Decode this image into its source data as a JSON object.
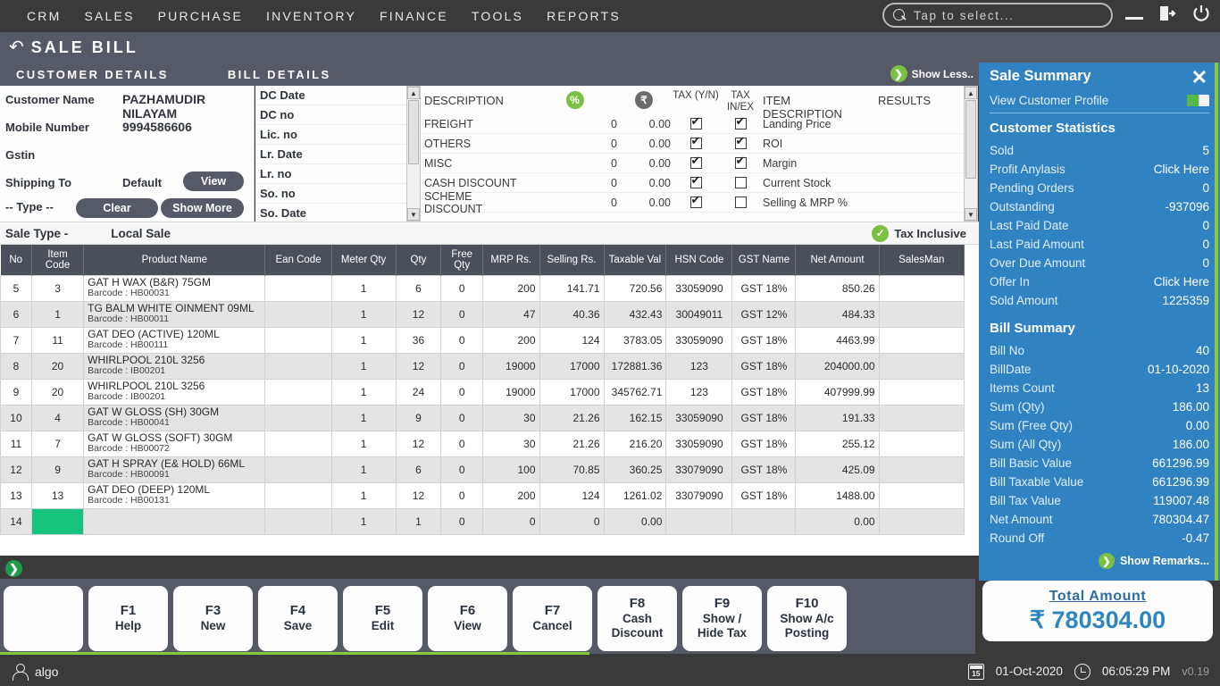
{
  "topnav": {
    "menus": [
      "CRM",
      "SALES",
      "PURCHASE",
      "INVENTORY",
      "FINANCE",
      "TOOLS",
      "REPORTS"
    ],
    "search_placeholder": "Tap to select...",
    "search_icon": "search-icon",
    "minimize_label": "—",
    "logout_icon": "logout-icon",
    "power_icon": "power-icon",
    "bg": "#3a3a3a"
  },
  "titlebar": {
    "back_icon": "↰",
    "title": "SALE BILL",
    "bg": "#555a66"
  },
  "sections": {
    "customer_details": "CUSTOMER DETAILS",
    "bill_details": "BILL DETAILS",
    "show_less": "Show Less..",
    "show_less_icon": "chevron-right-icon"
  },
  "customer": {
    "fields": [
      {
        "label": "Customer Name",
        "value": "PAZHAMUDIR NILAYAM"
      },
      {
        "label": "Mobile Number",
        "value": "9994586606"
      },
      {
        "label": "Gstin",
        "value": ""
      },
      {
        "label": "Shipping To",
        "value": ""
      },
      {
        "label": "-- Type --",
        "value": ""
      }
    ],
    "default_label": "Default",
    "view_button": "View",
    "clear_button": "Clear",
    "showmore_button": "Show More"
  },
  "bill_left_list": [
    "DC Date",
    "DC no",
    "Lic. no",
    "Lr. Date",
    "Lr. no",
    "So. no",
    "So. Date"
  ],
  "bill_table": {
    "headers": {
      "description": "DESCRIPTION",
      "percent_badge": "%",
      "rupee_badge": "₹",
      "tax_yn": "TAX (Y/N)",
      "tax_inex": "TAX IN/EX",
      "item_description": "ITEM DESCRIPTION",
      "results": "RESULTS"
    },
    "percent_badge_color": "#7ac143",
    "rupee_badge_color": "#6b6b6b",
    "rows": [
      {
        "desc": "FREIGHT",
        "pct": "0",
        "amt": "0.00",
        "tax_yn": true,
        "tax_inex": true,
        "item": "Landing Price",
        "result": ""
      },
      {
        "desc": "OTHERS",
        "pct": "0",
        "amt": "0.00",
        "tax_yn": true,
        "tax_inex": true,
        "item": "ROI",
        "result": ""
      },
      {
        "desc": "MISC",
        "pct": "0",
        "amt": "0.00",
        "tax_yn": true,
        "tax_inex": true,
        "item": "Margin",
        "result": ""
      },
      {
        "desc": "CASH DISCOUNT",
        "pct": "0",
        "amt": "0.00",
        "tax_yn": true,
        "tax_inex": false,
        "item": "Current Stock",
        "result": ""
      },
      {
        "desc": "SCHEME DISCOUNT",
        "pct": "0",
        "amt": "0.00",
        "tax_yn": true,
        "tax_inex": false,
        "item": "Selling & MRP %",
        "result": ""
      }
    ]
  },
  "sale_type": {
    "label": "Sale Type -",
    "value": "Local Sale",
    "tax_inclusive": "Tax Inclusive",
    "tax_inclusive_icon": "check-circle-icon"
  },
  "grid": {
    "columns": [
      "No",
      "Item Code",
      "Product Name",
      "Ean Code",
      "Meter Qty",
      "Qty",
      "Free Qty",
      "MRP Rs.",
      "Selling Rs.",
      "Taxable Val",
      "HSN Code",
      "GST Name",
      "Net Amount",
      "SalesMan"
    ],
    "rows": [
      {
        "no": "5",
        "item_code": "3",
        "name": "GAT H WAX (B&R) 75GM",
        "barcode": "Barcode : HB00031",
        "ean": "",
        "meter": "1",
        "qty": "6",
        "free": "0",
        "mrp": "200",
        "selling": "141.71",
        "taxable": "720.56",
        "hsn": "33059090",
        "gst": "GST 18%",
        "net": "850.26",
        "salesman": ""
      },
      {
        "no": "6",
        "item_code": "1",
        "name": "TG BALM WHITE OINMENT 09ML",
        "barcode": "Barcode : HB00011",
        "ean": "",
        "meter": "1",
        "qty": "12",
        "free": "0",
        "mrp": "47",
        "selling": "40.36",
        "taxable": "432.43",
        "hsn": "30049011",
        "gst": "GST 12%",
        "net": "484.33",
        "salesman": ""
      },
      {
        "no": "7",
        "item_code": "11",
        "name": "GAT DEO (ACTIVE) 120ML",
        "barcode": "Barcode : HB00111",
        "ean": "",
        "meter": "1",
        "qty": "36",
        "free": "0",
        "mrp": "200",
        "selling": "124",
        "taxable": "3783.05",
        "hsn": "33059090",
        "gst": "GST 18%",
        "net": "4463.99",
        "salesman": ""
      },
      {
        "no": "8",
        "item_code": "20",
        "name": "WHIRLPOOL  210L 3256",
        "barcode": "Barcode : IB00201",
        "ean": "",
        "meter": "1",
        "qty": "12",
        "free": "0",
        "mrp": "19000",
        "selling": "17000",
        "taxable": "172881.36",
        "hsn": "123",
        "gst": "GST 18%",
        "net": "204000.00",
        "salesman": ""
      },
      {
        "no": "9",
        "item_code": "20",
        "name": "WHIRLPOOL  210L 3256",
        "barcode": "Barcode : IB00201",
        "ean": "",
        "meter": "1",
        "qty": "24",
        "free": "0",
        "mrp": "19000",
        "selling": "17000",
        "taxable": "345762.71",
        "hsn": "123",
        "gst": "GST 18%",
        "net": "407999.99",
        "salesman": ""
      },
      {
        "no": "10",
        "item_code": "4",
        "name": "GAT W GLOSS (SH) 30GM",
        "barcode": "Barcode : HB00041",
        "ean": "",
        "meter": "1",
        "qty": "9",
        "free": "0",
        "mrp": "30",
        "selling": "21.26",
        "taxable": "162.15",
        "hsn": "33059090",
        "gst": "GST 18%",
        "net": "191.33",
        "salesman": ""
      },
      {
        "no": "11",
        "item_code": "7",
        "name": "GAT W GLOSS (SOFT) 30GM",
        "barcode": "Barcode : HB00072",
        "ean": "",
        "meter": "1",
        "qty": "12",
        "free": "0",
        "mrp": "30",
        "selling": "21.26",
        "taxable": "216.20",
        "hsn": "33059090",
        "gst": "GST 18%",
        "net": "255.12",
        "salesman": ""
      },
      {
        "no": "12",
        "item_code": "9",
        "name": "GAT H SPRAY (E& HOLD) 66ML",
        "barcode": "Barcode : HB00091",
        "ean": "",
        "meter": "1",
        "qty": "6",
        "free": "0",
        "mrp": "100",
        "selling": "70.85",
        "taxable": "360.25",
        "hsn": "33079090",
        "gst": "GST 18%",
        "net": "425.09",
        "salesman": ""
      },
      {
        "no": "13",
        "item_code": "13",
        "name": "GAT DEO (DEEP) 120ML",
        "barcode": "Barcode : HB00131",
        "ean": "",
        "meter": "1",
        "qty": "12",
        "free": "0",
        "mrp": "200",
        "selling": "124",
        "taxable": "1261.02",
        "hsn": "33079090",
        "gst": "GST 18%",
        "net": "1488.00",
        "salesman": ""
      },
      {
        "no": "14",
        "item_code": "",
        "name": "",
        "barcode": "",
        "ean": "",
        "meter": "1",
        "qty": "1",
        "free": "0",
        "mrp": "0",
        "selling": "0",
        "taxable": "0.00",
        "hsn": "",
        "gst": "",
        "net": "0.00",
        "salesman": ""
      }
    ],
    "active_cell_color": "#17c27f",
    "expand_icon": "chevron-right-icon"
  },
  "function_bar": [
    {
      "key": "",
      "desc": ""
    },
    {
      "key": "F1",
      "desc": "Help"
    },
    {
      "key": "F3",
      "desc": "New"
    },
    {
      "key": "F4",
      "desc": "Save"
    },
    {
      "key": "F5",
      "desc": "Edit"
    },
    {
      "key": "F6",
      "desc": "View"
    },
    {
      "key": "F7",
      "desc": "Cancel"
    },
    {
      "key": "F8",
      "desc": "Cash Discount"
    },
    {
      "key": "F9",
      "desc": "Show / Hide Tax"
    },
    {
      "key": "F10",
      "desc": "Show A/c Posting"
    }
  ],
  "sidebar": {
    "title": "Sale Summary",
    "close_icon": "close-icon",
    "view_customer_profile": "View Customer Profile",
    "customer_statistics_title": "Customer Statistics",
    "customer_statistics": [
      {
        "label": "Sold",
        "value": "5"
      },
      {
        "label": "Profit Anylasis",
        "value": "Click Here"
      },
      {
        "label": "Pending Orders",
        "value": "0"
      },
      {
        "label": "Outstanding",
        "value": "-937096"
      },
      {
        "label": "Last Paid Date",
        "value": "0"
      },
      {
        "label": "Last Paid Amount",
        "value": "0"
      },
      {
        "label": "Over Due Amount",
        "value": "0"
      },
      {
        "label": "Offer In",
        "value": "Click Here"
      },
      {
        "label": "Sold Amount",
        "value": "1225359"
      }
    ],
    "bill_summary_title": "Bill Summary",
    "bill_summary": [
      {
        "label": "Bill No",
        "value": "40"
      },
      {
        "label": "BillDate",
        "value": "01-10-2020"
      },
      {
        "label": "Items Count",
        "value": "13"
      },
      {
        "label": "Sum (Qty)",
        "value": "186.00"
      },
      {
        "label": "Sum (Free Qty)",
        "value": "0.00"
      },
      {
        "label": "Sum (All Qty)",
        "value": "186.00"
      },
      {
        "label": "Bill Basic Value",
        "value": "661296.99"
      },
      {
        "label": "Bill Taxable Value",
        "value": "661296.99"
      },
      {
        "label": "Bill Tax Value",
        "value": "119007.48"
      },
      {
        "label": "Net Amount",
        "value": "780304.47"
      },
      {
        "label": "Round Off",
        "value": "-0.47"
      }
    ],
    "show_remarks": "Show Remarks...",
    "show_remarks_icon": "chevron-right-icon",
    "bg": "#3083c0"
  },
  "total": {
    "label": "Total Amount",
    "currency": "₹",
    "amount": "780304.00"
  },
  "statusbar": {
    "user_icon": "user-icon",
    "user": "algo",
    "calendar_icon": "calendar-icon",
    "date": "01-Oct-2020",
    "clock_icon": "clock-icon",
    "time": "06:05:29 PM",
    "version": "v0.19"
  }
}
